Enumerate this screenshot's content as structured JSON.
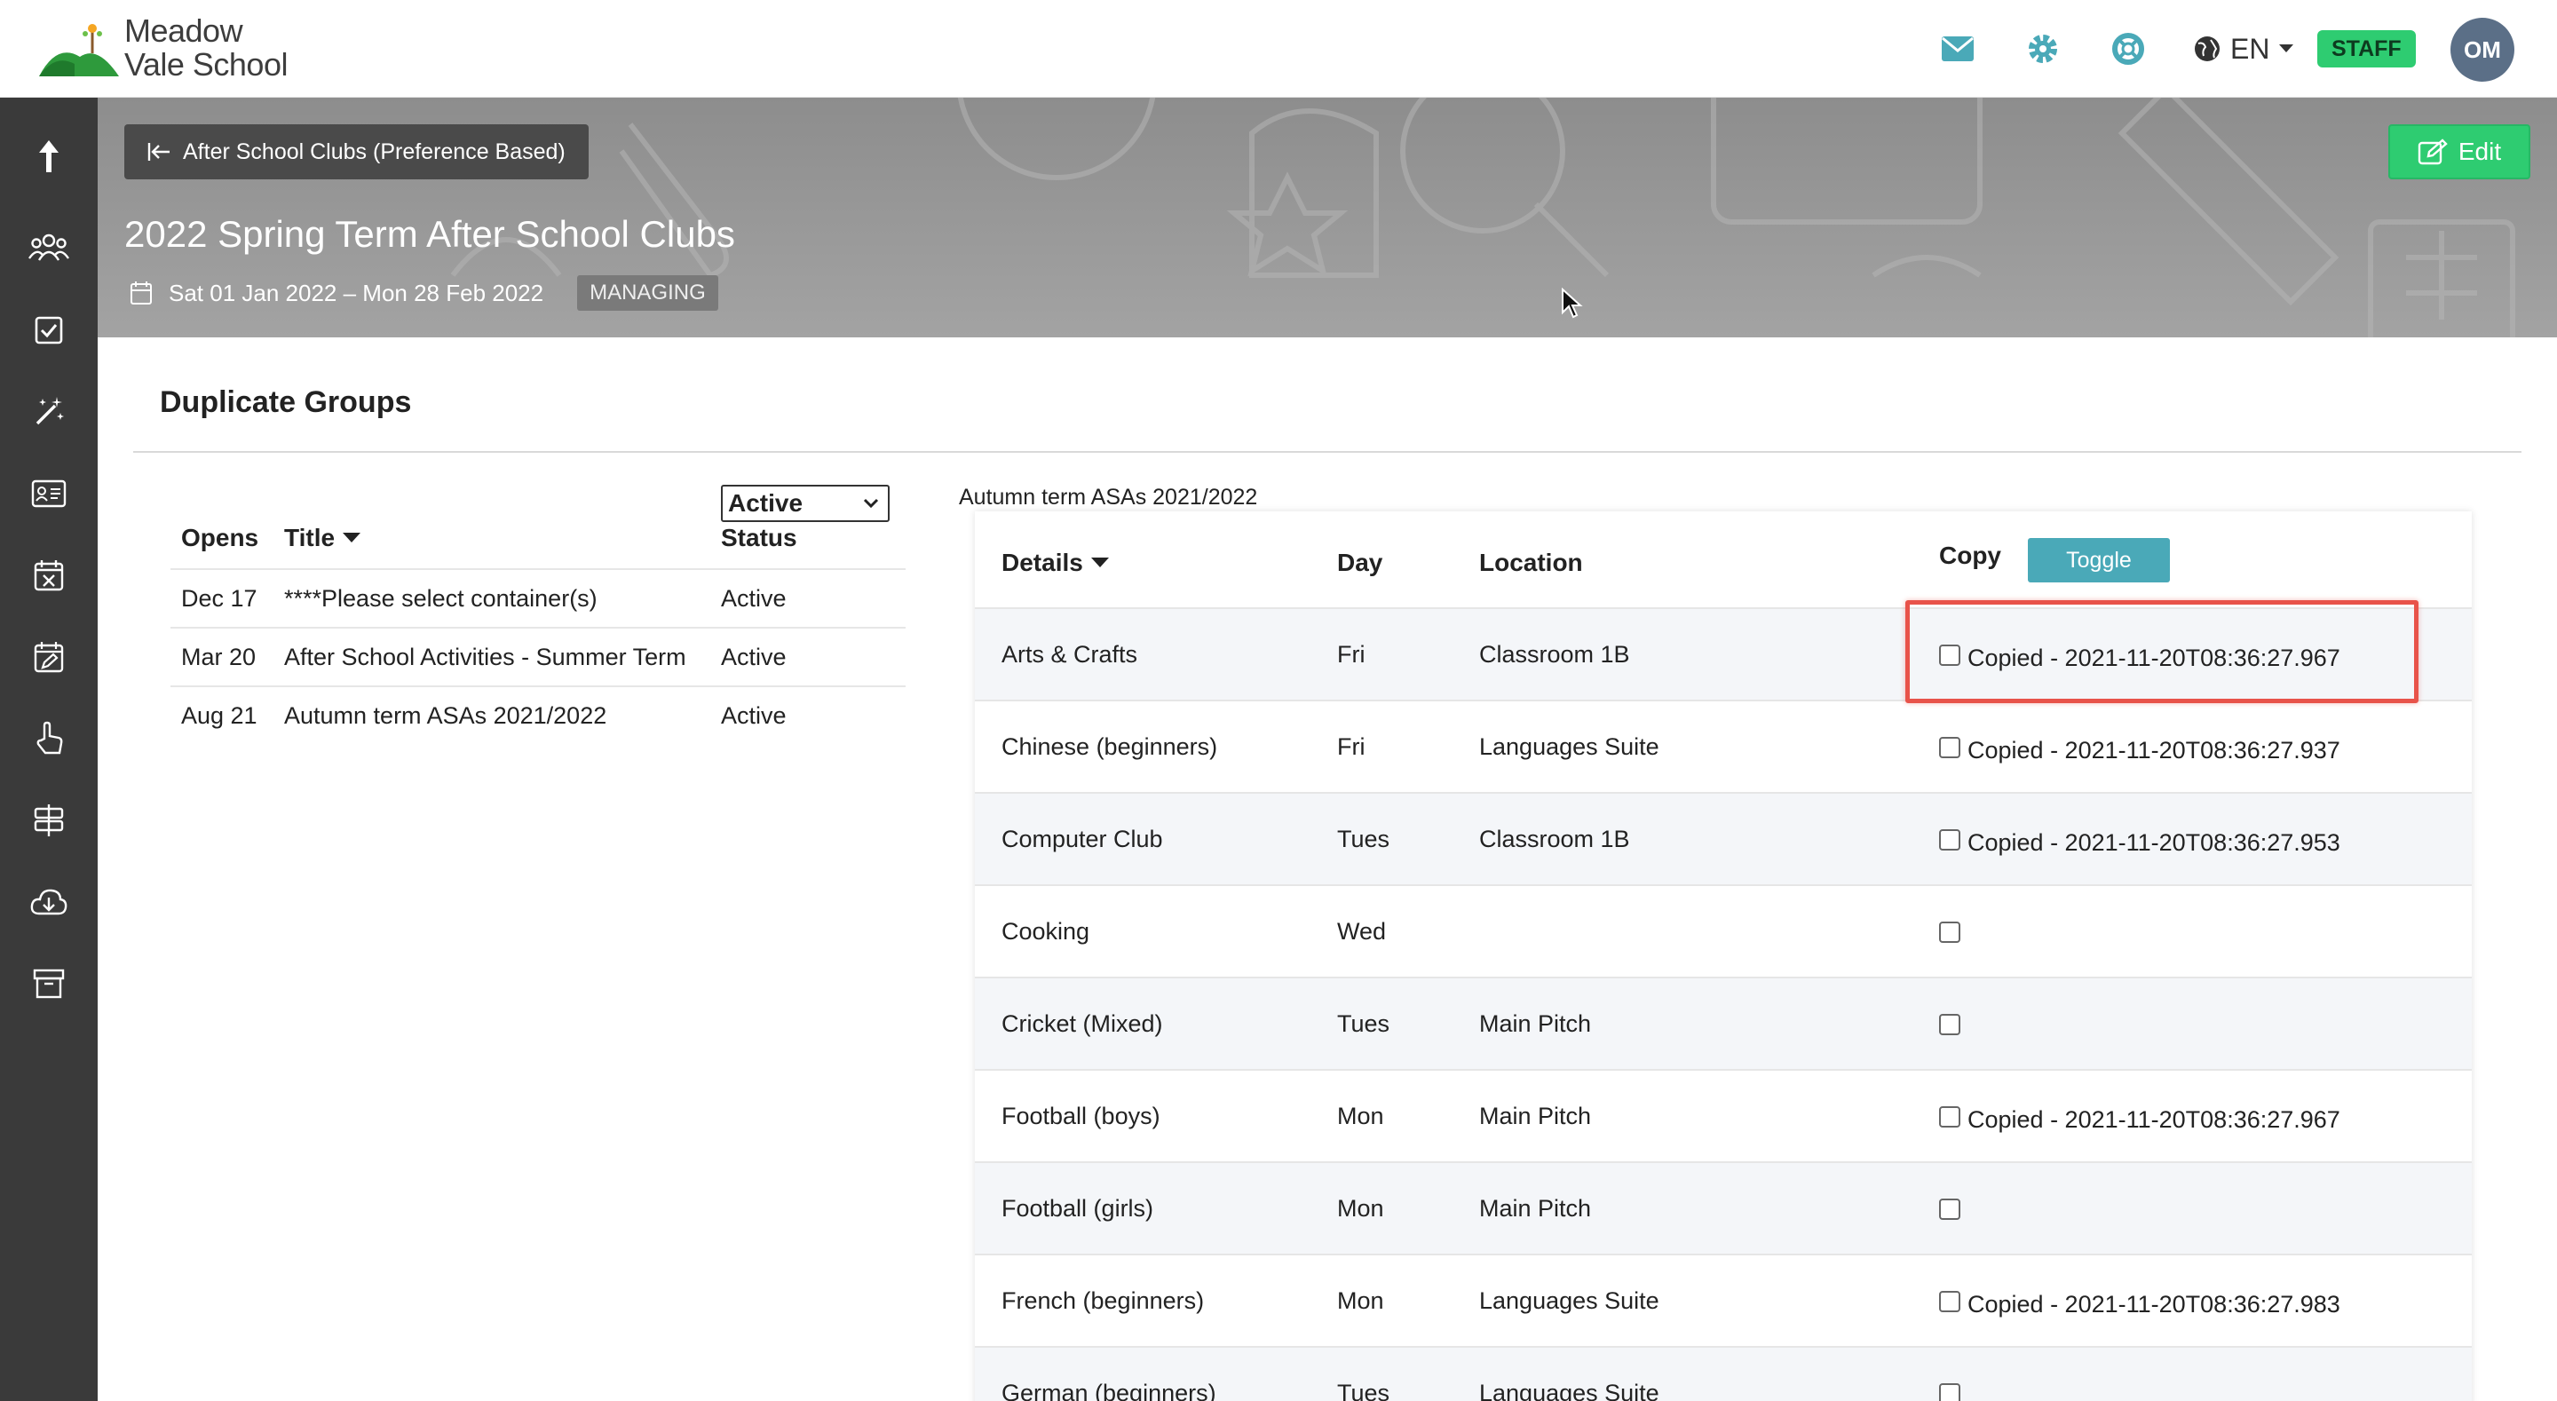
{
  "brand": {
    "name_line1": "Meadow",
    "name_line2": "Vale School"
  },
  "topbar": {
    "language": "EN",
    "role_badge": "STAFF",
    "avatar_initials": "OM",
    "icons": [
      "mail-icon",
      "gear-icon",
      "help-lifebuoy-icon",
      "globe-icon",
      "caret-down-icon"
    ]
  },
  "sidebar": {
    "items": [
      "upload-arrow-icon",
      "users-group-icon",
      "checkbox-icon",
      "magic-wand-icon",
      "id-card-icon",
      "calendar-x-icon",
      "calendar-edit-icon",
      "hand-pointer-icon",
      "signpost-icon",
      "cloud-download-icon",
      "archive-box-icon"
    ]
  },
  "header": {
    "back_label": "After School Clubs (Preference Based)",
    "edit_label": "Edit",
    "title": "2022 Spring Term After School Clubs",
    "date_range": "Sat 01 Jan 2022 – Mon 28 Feb 2022",
    "status_tag": "MANAGING"
  },
  "main": {
    "section_title": "Duplicate Groups",
    "left_table": {
      "status_filter": "Active",
      "columns": {
        "opens": "Opens",
        "title": "Title",
        "status": "Status"
      },
      "rows": [
        {
          "opens": "Dec 17",
          "title": "****Please select container(s)",
          "status": "Active"
        },
        {
          "opens": "Mar 20",
          "title": "After School Activities - Summer Term",
          "status": "Active"
        },
        {
          "opens": "Aug 21",
          "title": "Autumn term ASAs 2021/2022",
          "status": "Active"
        }
      ]
    },
    "right_table": {
      "caption": "Autumn term ASAs 2021/2022",
      "columns": {
        "details": "Details",
        "day": "Day",
        "location": "Location",
        "copy": "Copy"
      },
      "toggle_label": "Toggle",
      "rows": [
        {
          "details": "Arts & Crafts",
          "day": "Fri",
          "location": "Classroom 1B",
          "copied": "Copied - 2021-11-20T08:36:27.967"
        },
        {
          "details": "Chinese (beginners)",
          "day": "Fri",
          "location": "Languages Suite",
          "copied": "Copied - 2021-11-20T08:36:27.937"
        },
        {
          "details": "Computer Club",
          "day": "Tues",
          "location": "Classroom 1B",
          "copied": "Copied - 2021-11-20T08:36:27.953"
        },
        {
          "details": "Cooking",
          "day": "Wed",
          "location": "",
          "copied": ""
        },
        {
          "details": "Cricket (Mixed)",
          "day": "Tues",
          "location": "Main Pitch",
          "copied": ""
        },
        {
          "details": "Football (boys)",
          "day": "Mon",
          "location": "Main Pitch",
          "copied": "Copied - 2021-11-20T08:36:27.967"
        },
        {
          "details": "Football (girls)",
          "day": "Mon",
          "location": "Main Pitch",
          "copied": ""
        },
        {
          "details": "French (beginners)",
          "day": "Mon",
          "location": "Languages Suite",
          "copied": "Copied - 2021-11-20T08:36:27.983"
        },
        {
          "details": "German (beginners)",
          "day": "Tues",
          "location": "Languages Suite",
          "copied": ""
        }
      ]
    }
  },
  "colors": {
    "accent_green": "#2ecc71",
    "toggle_teal": "#4aa9b8",
    "highlight_red": "#e8534a",
    "sidebar_bg": "#3a3a3a"
  }
}
